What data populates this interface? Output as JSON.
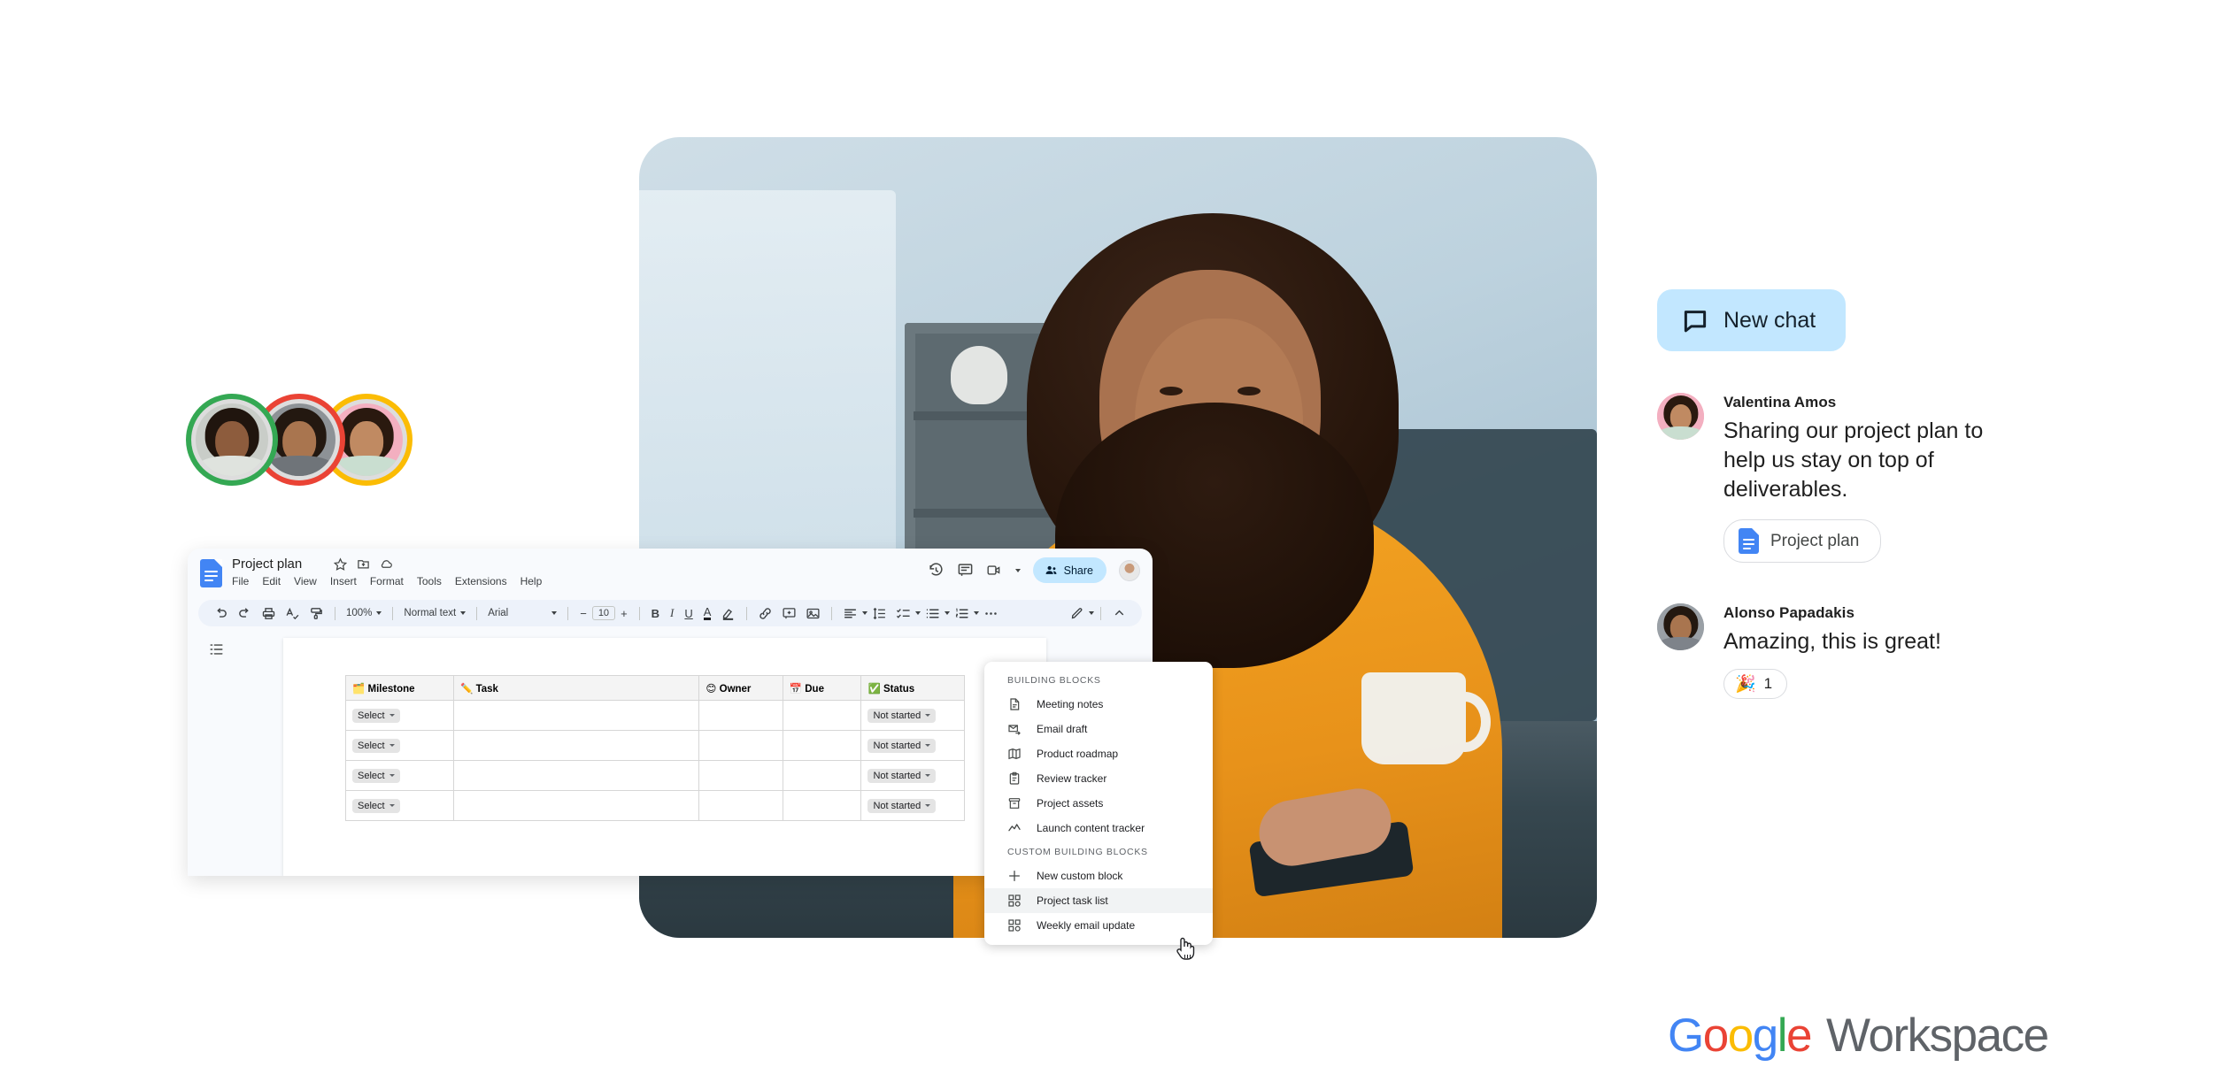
{
  "avatars": {
    "group_label": "collaborator-avatars",
    "ring_colors": [
      "#34a853",
      "#ea4335",
      "#fbbc04"
    ]
  },
  "docs_window": {
    "doc_title": "Project plan",
    "title_icons": [
      "star-icon",
      "move-to-folder-icon",
      "cloud-saved-icon"
    ],
    "menubar": [
      "File",
      "Edit",
      "View",
      "Insert",
      "Format",
      "Tools",
      "Extensions",
      "Help"
    ],
    "titlebar_right": {
      "history_icon": "version-history-icon",
      "comment_icon": "comment-icon",
      "meet_icon": "meet-camera-icon",
      "share_label": "Share",
      "account_avatar": "account-avatar"
    },
    "toolbar": {
      "undo": "undo-icon",
      "redo": "redo-icon",
      "print": "print-icon",
      "spellcheck": "spellcheck-icon",
      "paint_format": "paint-format-icon",
      "zoom_value": "100%",
      "style_value": "Normal text",
      "font_value": "Arial",
      "font_size_minus": "−",
      "font_size_value": "10",
      "font_size_plus": "+",
      "bold": "B",
      "italic": "I",
      "underline": "U",
      "text_color": "A",
      "highlight": "highlight-icon",
      "link": "insert-link-icon",
      "comment": "add-comment-icon",
      "image": "insert-image-icon",
      "align": "align-icon",
      "line_spacing": "line-spacing-icon",
      "checklist": "checklist-icon",
      "bulleted_list": "bulleted-list-icon",
      "numbered_list": "numbered-list-icon",
      "more": "more-options-icon",
      "edit_mode": "edit-mode-pencil-icon",
      "collapse": "collapse-toolbar-icon"
    },
    "outline_icon": "document-outline-icon",
    "table": {
      "headers": [
        {
          "emoji": "🗂️",
          "label": "Milestone"
        },
        {
          "emoji": "✏️",
          "label": "Task"
        },
        {
          "emoji": "😊",
          "label": "Owner"
        },
        {
          "emoji": "📅",
          "label": "Due"
        },
        {
          "emoji": "✅",
          "label": "Status"
        }
      ],
      "rows": [
        {
          "milestone": "Select",
          "task": "",
          "owner": "",
          "due": "",
          "status": "Not started"
        },
        {
          "milestone": "Select",
          "task": "",
          "owner": "",
          "due": "",
          "status": "Not started"
        },
        {
          "milestone": "Select",
          "task": "",
          "owner": "",
          "due": "",
          "status": "Not started"
        },
        {
          "milestone": "Select",
          "task": "",
          "owner": "",
          "due": "",
          "status": "Not started"
        }
      ]
    }
  },
  "building_blocks_menu": {
    "section_1_title": "BUILDING BLOCKS",
    "section_1_items": [
      {
        "label": "Meeting notes",
        "icon": "document-icon"
      },
      {
        "label": "Email draft",
        "icon": "email-draft-icon"
      },
      {
        "label": "Product roadmap",
        "icon": "roadmap-map-icon"
      },
      {
        "label": "Review tracker",
        "icon": "clipboard-icon"
      },
      {
        "label": "Project assets",
        "icon": "archive-box-icon"
      },
      {
        "label": "Launch content tracker",
        "icon": "trend-line-icon"
      }
    ],
    "section_2_title": "CUSTOM BUILDING BLOCKS",
    "section_2_items": [
      {
        "label": "New custom block",
        "icon": "plus-icon"
      },
      {
        "label": "Project task list",
        "icon": "blocks-grid-icon",
        "highlighted": true
      },
      {
        "label": "Weekly email update",
        "icon": "blocks-grid-icon"
      }
    ],
    "cursor": "pointing-hand-cursor"
  },
  "chat": {
    "new_chat_label": "New chat",
    "new_chat_icon": "chat-bubble-icon",
    "new_chat_bg": "#c2e7ff",
    "messages": [
      {
        "name": "Valentina Amos",
        "text": "Sharing our project plan to help us stay on top of deliverables.",
        "attachment": {
          "label": "Project plan",
          "icon": "google-docs-icon"
        },
        "avatar_bg": "#f3afc0"
      },
      {
        "name": "Alonso Papadakis",
        "text": "Amazing, this is great!",
        "reaction": {
          "emoji": "🎉",
          "count": "1"
        },
        "avatar_bg": "#9aa0a6"
      }
    ]
  },
  "branding": {
    "google_letters": [
      "G",
      "o",
      "o",
      "g",
      "l",
      "e"
    ],
    "workspace_word": "Workspace",
    "colors": {
      "blue": "#4285f4",
      "red": "#ea4335",
      "yellow": "#fbbc04",
      "green": "#34a853",
      "gray": "#5f6368"
    }
  }
}
